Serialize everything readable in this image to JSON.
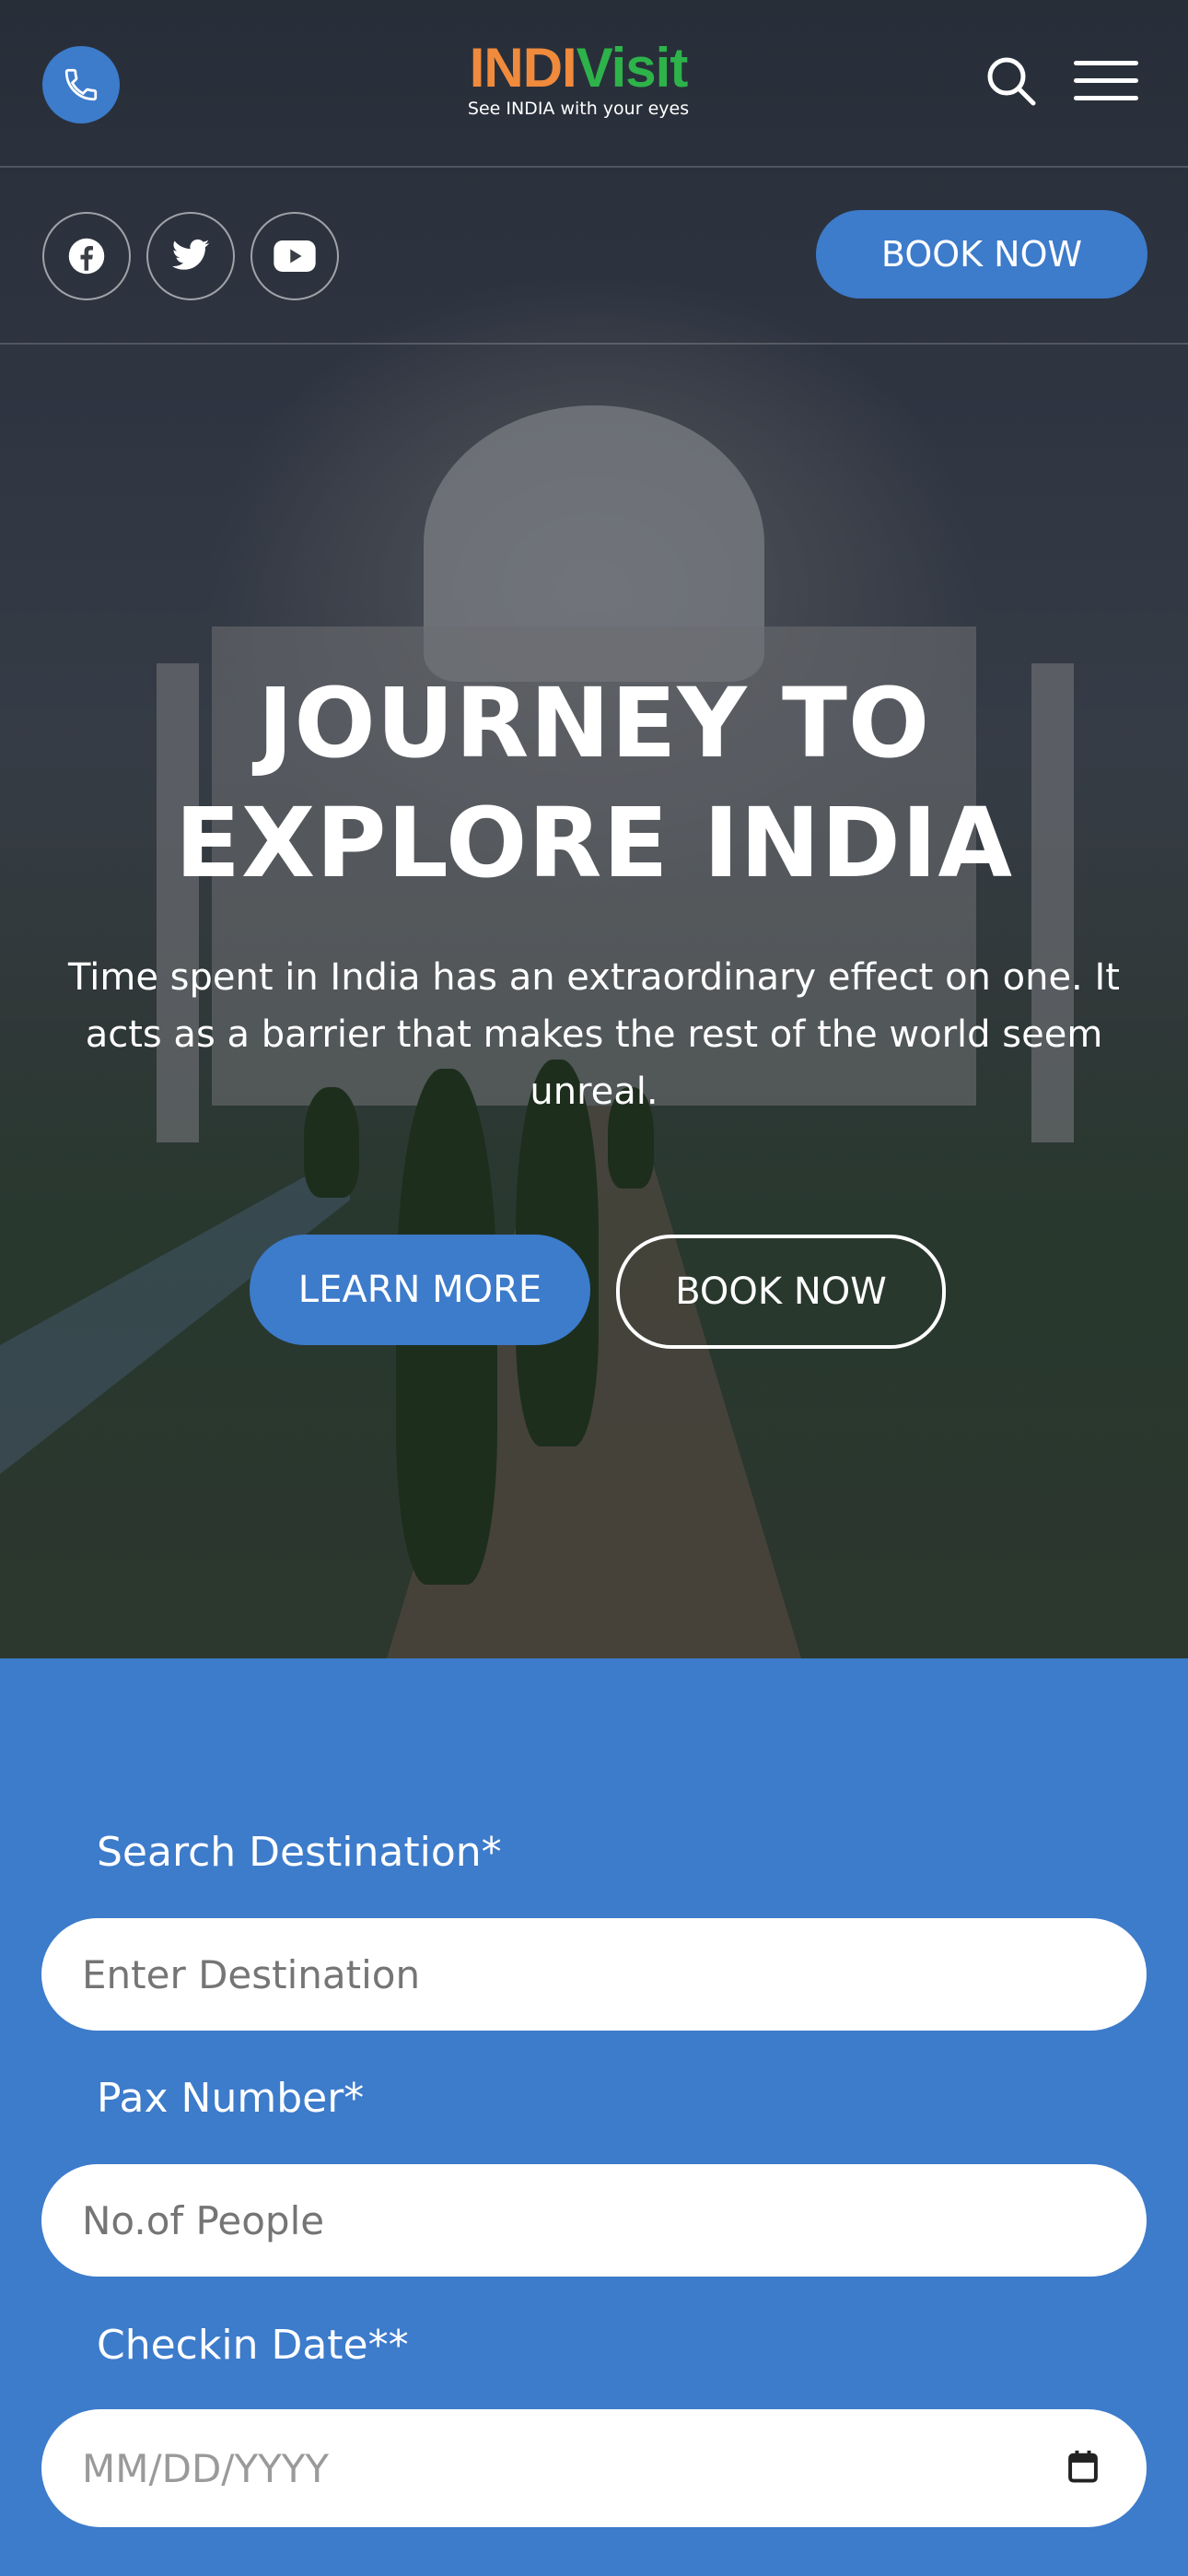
{
  "brand": {
    "part1": "INDI",
    "part2": "Visit",
    "tagline": "See INDIA with your eyes"
  },
  "header": {
    "phone_icon": "phone-icon",
    "search_icon": "search-icon",
    "menu_icon": "hamburger-menu-icon"
  },
  "social": {
    "items": [
      "facebook-icon",
      "twitter-icon",
      "youtube-icon"
    ],
    "book_label": "BOOK NOW"
  },
  "hero": {
    "title_line1": "JOURNEY TO",
    "title_line2": "EXPLORE INDIA",
    "subtitle": "Time spent in India has an extraordinary effect on one. It acts as a barrier that makes the rest of the world seem unreal.",
    "learn_label": "LEARN MORE",
    "book_label": "BOOK NOW"
  },
  "form": {
    "destination_label": "Search Destination*",
    "destination_placeholder": "Enter Destination",
    "pax_label": "Pax Number*",
    "pax_placeholder": "No.of People",
    "checkin_label": "Checkin Date**",
    "checkin_placeholder": "MM/DD/YYYY"
  },
  "colors": {
    "accent": "#3d7bcb",
    "logo_orange": "#f08a3c",
    "logo_green": "#2db34a"
  }
}
